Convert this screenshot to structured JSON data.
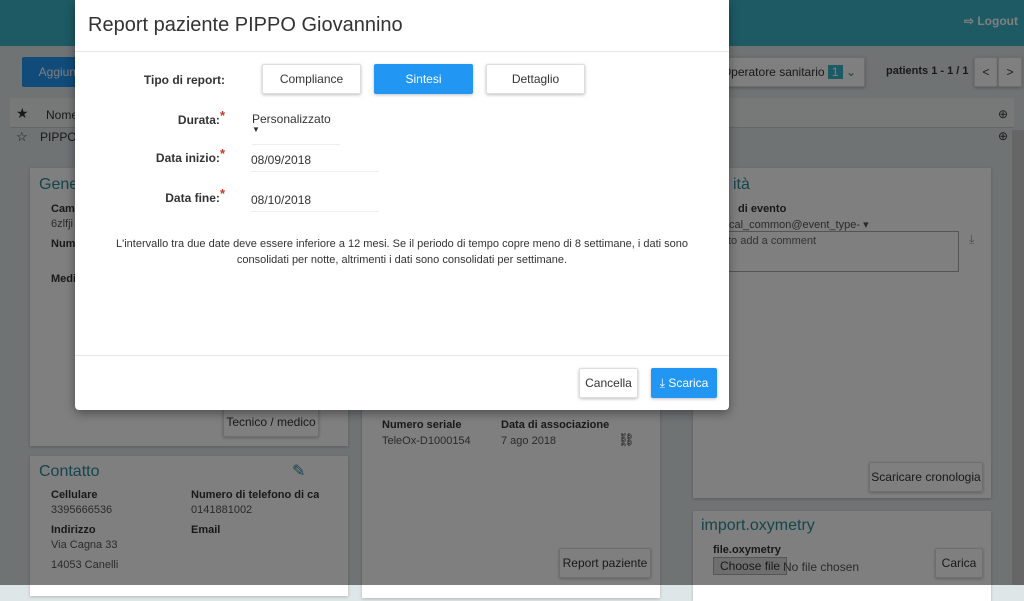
{
  "header": {
    "logout": "Logout"
  },
  "toolbar": {
    "add_label": "Aggiungi",
    "role_filter": "Operatore sanitario",
    "role_count": "1",
    "pagination": "patients 1 - 1 / 1",
    "prev": "<",
    "next": ">"
  },
  "table": {
    "header_name": "Nome",
    "row_name": "PIPPO"
  },
  "general_card": {
    "title": "Gene",
    "field1_label": "Cam",
    "field1_value": "6zlfji",
    "field2_label": "Num",
    "field3_label": "Medi",
    "button": "Tecnico / medico"
  },
  "contact_card": {
    "title": "Contatto",
    "mobile_label": "Cellulare",
    "mobile_value": "3395666536",
    "home_label": "Numero di telefono di cas",
    "home_value": "0141881002",
    "address_label": "Indirizzo",
    "address_line1": "Via Cagna 33",
    "address_line2": "14053 Canelli",
    "email_label": "Email"
  },
  "device_card": {
    "serial_label": "Numero seriale",
    "serial_value": "TeleOx-D1000154",
    "assoc_label": "Data di associazione",
    "assoc_value": "7 ago 2018",
    "report_button": "Report paziente"
  },
  "activity_card": {
    "title": "ità",
    "event_label": "di evento",
    "event_value": "cal_common@event_type-",
    "comment_placeholder": "to add a comment",
    "history_button": "Scaricare cronologia"
  },
  "import_card": {
    "title": "import.oxymetry",
    "file_label": "file.oxymetry",
    "choose_file": "Choose file",
    "no_file": "No file chosen",
    "upload_button": "Carica"
  },
  "modal": {
    "title": "Report paziente PIPPO Giovannino",
    "report_type_label": "Tipo di report:",
    "report_types": [
      "Compliance",
      "Sintesi",
      "Dettaglio"
    ],
    "selected_type": "Sintesi",
    "duration_label": "Durata:",
    "duration_value": "Personalizzato",
    "start_label": "Data inizio:",
    "start_value": "08/09/2018",
    "end_label": "Data fine:",
    "end_value": "08/10/2018",
    "required_mark": "*",
    "note": "L'intervallo tra due date deve essere inferiore a 12 mesi. Se il periodo di tempo copre meno di 8 settimane, i dati sono consolidati per notte, altrimenti i dati sono consolidati per settimane.",
    "cancel": "Cancella",
    "download": "Scarica"
  },
  "colors": {
    "primary": "#2196f3",
    "header": "#3ab4c6",
    "title": "#2a8a9a",
    "required": "#c0392b"
  }
}
